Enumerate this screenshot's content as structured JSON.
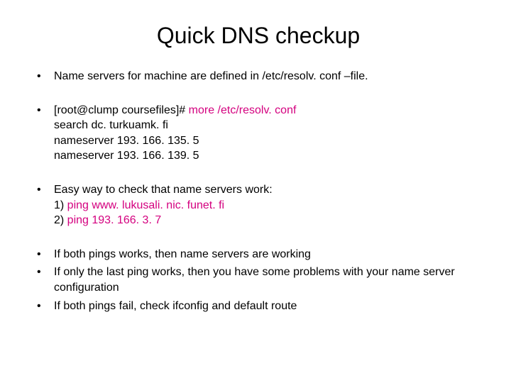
{
  "title": "Quick DNS checkup",
  "b1": "Name servers for machine are defined in /etc/resolv. conf –file.",
  "b2": {
    "prompt": "[root@clump coursefiles]# ",
    "cmd": "more /etc/resolv. conf",
    "l1": "search dc. turkuamk. fi",
    "l2": "nameserver 193. 166. 135. 5",
    "l3": "nameserver 193. 166. 139. 5"
  },
  "b3": {
    "intro": "Easy way to check that name servers work:",
    "p1a": "1) ",
    "p1b": "ping www. lukusali. nic. funet. fi",
    "p2a": "2) ",
    "p2b": "ping 193. 166. 3. 7"
  },
  "b4": "If both pings works, then name servers are working",
  "b5": "If only the last ping works, then you have some problems with your name server configuration",
  "b6": "If both pings fail, check ifconfig and default route"
}
